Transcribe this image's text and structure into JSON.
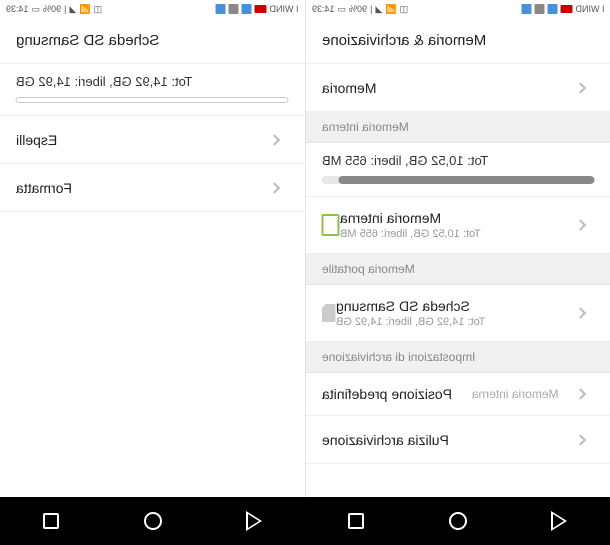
{
  "statusbar": {
    "carrier": "I WIND",
    "time": "14:39",
    "battery": "90%"
  },
  "leftPane": {
    "header": "Scheda SD Samsung",
    "storageSummary": "Tot: 14,92 GB, liberi: 14,92 GB",
    "items": {
      "eject": "Espelli",
      "format": "Formatta"
    }
  },
  "rightPane": {
    "header": "Memoria & archiviazione",
    "memoryTitle": "Memoria",
    "sections": {
      "internal": "Memoria interna",
      "portable": "Memoria portatile",
      "storageSettings": "Impostazioni di archiviazione"
    },
    "internalSummary": "Tot: 10,52 GB, liberi: 655 MB",
    "internalRow": {
      "title": "Memoria interna",
      "sub": "Tot: 10,52 GB, liberi: 655 MB"
    },
    "sdRow": {
      "title": "Scheda SD Samsung",
      "sub": "Tot: 14,92 GB, liberi: 14,92 GB"
    },
    "defaultLocation": {
      "label": "Posizione predefinita",
      "value": "Memoria interna"
    },
    "cleanup": "Pulizia archiviazione"
  },
  "progressPercent": 94,
  "emptyProgressPercent": 0
}
